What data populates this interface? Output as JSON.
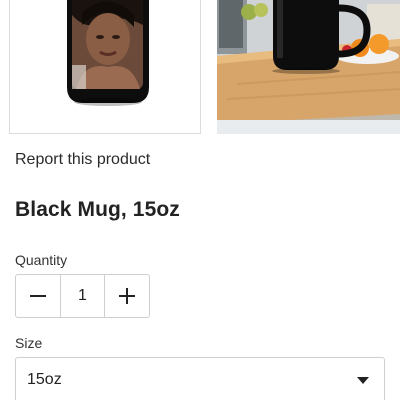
{
  "gallery": {
    "images": [
      {
        "icon": "mug-photo-icon"
      },
      {
        "icon": "mug-kitchen-photo-icon"
      }
    ]
  },
  "report_link": "Report this product",
  "product": {
    "title": "Black Mug, 15oz"
  },
  "quantity": {
    "label": "Quantity",
    "value": "1",
    "decrease_icon": "minus-icon",
    "increase_icon": "plus-icon"
  },
  "size": {
    "label": "Size",
    "selected": "15oz",
    "icon": "caret-down-icon"
  },
  "colors": {
    "text": "#222222",
    "border": "#cfcfcf",
    "mug": "#0d0d0d"
  }
}
